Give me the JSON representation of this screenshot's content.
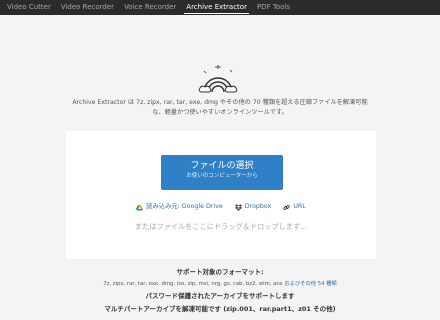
{
  "nav": {
    "tabs": [
      {
        "label": "Video Cutter"
      },
      {
        "label": "Video Recorder"
      },
      {
        "label": "Voice Recorder"
      },
      {
        "label": "Archive Extractor",
        "active": true
      },
      {
        "label": "PDF Tools"
      }
    ]
  },
  "hero": {
    "icon": "archive-rainbow-icon",
    "description": "Archive Extractor は 7z, zipx, rar, tar, exe, dmg やその他の 70 種類を超える圧縮ファイルを解凍可能な、軽量かつ使いやすいオンラインツールです。"
  },
  "upload": {
    "button_label": "ファイルの選択",
    "button_sublabel": "お使いのコンピューターから",
    "sources": [
      {
        "label": "読み込み元: Google Drive",
        "icon": "google-drive-icon"
      },
      {
        "label": "Dropbox",
        "icon": "dropbox-icon"
      },
      {
        "label": "URL",
        "icon": "link-icon"
      }
    ],
    "drop_hint": "またはファイルをここにドラッグ＆ドロップします..."
  },
  "formats": {
    "title": "サポート対象のフォーマット:",
    "list": "7z, zipx, rar, tar, exe, dmg, iso, zip, msi, nrg, gz, cab, bz2, wim, ace",
    "more_link": "およびその他 54 種類"
  },
  "notes": {
    "password": "パスワード保護されたアーカイブをサポートします",
    "multipart": "マルチパートアーカイブを解凍可能です (zip.001、rar.part1、z01 その他)"
  },
  "colors": {
    "topbar": "#2b2b2b",
    "accent": "#2f80c7",
    "link": "#2f6fb0",
    "background": "#f4f4f4"
  }
}
